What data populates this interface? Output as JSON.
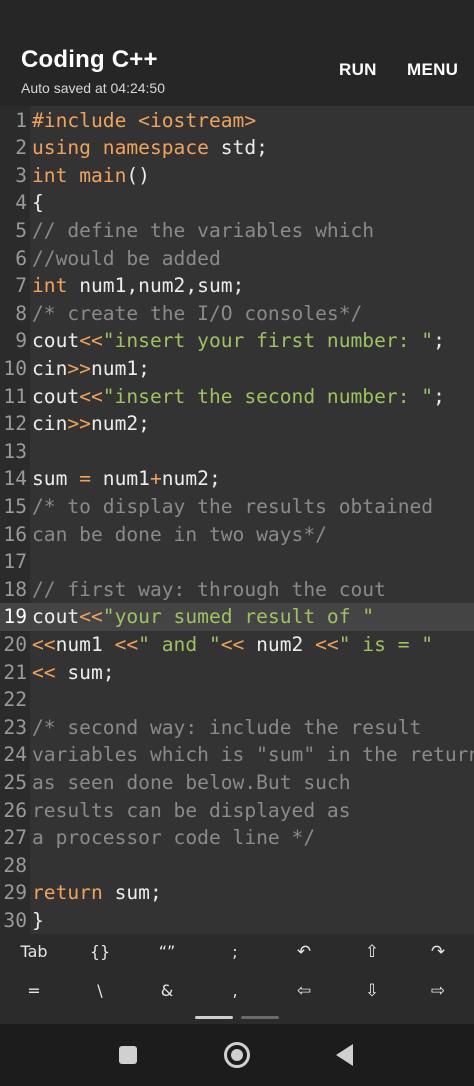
{
  "app": {
    "title": "Coding C++",
    "subtitle": "Auto saved at 04:24:50",
    "actions": {
      "run": "RUN",
      "menu": "MENU"
    }
  },
  "editor": {
    "active_line": 19,
    "lines": [
      {
        "n": "1",
        "tokens": [
          {
            "t": "#include ",
            "c": "kw"
          },
          {
            "t": "<iostream>",
            "c": "kw"
          }
        ]
      },
      {
        "n": "2",
        "tokens": [
          {
            "t": "using namespace ",
            "c": "kw"
          },
          {
            "t": "std;",
            "c": "pl"
          }
        ]
      },
      {
        "n": "3",
        "tokens": [
          {
            "t": "int ",
            "c": "kw"
          },
          {
            "t": "main",
            "c": "kw"
          },
          {
            "t": "()",
            "c": "pl"
          }
        ]
      },
      {
        "n": "4",
        "tokens": [
          {
            "t": "{",
            "c": "pl"
          }
        ]
      },
      {
        "n": "5",
        "tokens": [
          {
            "t": "// define the variables which",
            "c": "cm"
          }
        ]
      },
      {
        "n": "6",
        "tokens": [
          {
            "t": "//would be added",
            "c": "cm"
          }
        ]
      },
      {
        "n": "7",
        "tokens": [
          {
            "t": "int ",
            "c": "kw"
          },
          {
            "t": "num1,num2,sum;",
            "c": "pl"
          }
        ]
      },
      {
        "n": "8",
        "tokens": [
          {
            "t": "/* create the I/O consoles*/",
            "c": "cm"
          }
        ]
      },
      {
        "n": "9",
        "tokens": [
          {
            "t": "cout",
            "c": "pl"
          },
          {
            "t": "<<",
            "c": "op"
          },
          {
            "t": "\"insert your first number: \"",
            "c": "str"
          },
          {
            "t": ";",
            "c": "pl"
          }
        ]
      },
      {
        "n": "10",
        "tokens": [
          {
            "t": "cin",
            "c": "pl"
          },
          {
            "t": ">>",
            "c": "op"
          },
          {
            "t": "num1;",
            "c": "pl"
          }
        ]
      },
      {
        "n": "11",
        "tokens": [
          {
            "t": "cout",
            "c": "pl"
          },
          {
            "t": "<<",
            "c": "op"
          },
          {
            "t": "\"insert the second number: \"",
            "c": "str"
          },
          {
            "t": ";",
            "c": "pl"
          }
        ]
      },
      {
        "n": "12",
        "tokens": [
          {
            "t": "cin",
            "c": "pl"
          },
          {
            "t": ">>",
            "c": "op"
          },
          {
            "t": "num2;",
            "c": "pl"
          }
        ]
      },
      {
        "n": "13",
        "tokens": []
      },
      {
        "n": "14",
        "tokens": [
          {
            "t": "sum ",
            "c": "pl"
          },
          {
            "t": "=",
            "c": "op"
          },
          {
            "t": " num1",
            "c": "pl"
          },
          {
            "t": "+",
            "c": "op"
          },
          {
            "t": "num2;",
            "c": "pl"
          }
        ]
      },
      {
        "n": "15",
        "tokens": [
          {
            "t": "/* to display the results obtained",
            "c": "cm"
          }
        ]
      },
      {
        "n": "16",
        "tokens": [
          {
            "t": "can be done in two ways*/",
            "c": "cm"
          }
        ]
      },
      {
        "n": "17",
        "tokens": []
      },
      {
        "n": "18",
        "tokens": [
          {
            "t": "// first way: through the cout",
            "c": "cm"
          }
        ]
      },
      {
        "n": "19",
        "tokens": [
          {
            "t": "cout",
            "c": "pl"
          },
          {
            "t": "<<",
            "c": "op"
          },
          {
            "t": "\"your sumed result of \"",
            "c": "str"
          }
        ]
      },
      {
        "n": "20",
        "tokens": [
          {
            "t": "<<",
            "c": "op"
          },
          {
            "t": "num1 ",
            "c": "pl"
          },
          {
            "t": "<<",
            "c": "op"
          },
          {
            "t": "\" and \"",
            "c": "str"
          },
          {
            "t": "<<",
            "c": "op"
          },
          {
            "t": " num2 ",
            "c": "pl"
          },
          {
            "t": "<<",
            "c": "op"
          },
          {
            "t": "\" is = \"",
            "c": "str"
          }
        ]
      },
      {
        "n": "21",
        "tokens": [
          {
            "t": "<<",
            "c": "op"
          },
          {
            "t": " sum;",
            "c": "pl"
          }
        ]
      },
      {
        "n": "22",
        "tokens": []
      },
      {
        "n": "23",
        "tokens": [
          {
            "t": "/* second way: include the result",
            "c": "cm"
          }
        ]
      },
      {
        "n": "24",
        "tokens": [
          {
            "t": "variables which is \"sum\" in the return",
            "c": "cm"
          }
        ]
      },
      {
        "n": "25",
        "tokens": [
          {
            "t": "as seen done below.But such",
            "c": "cm"
          }
        ]
      },
      {
        "n": "26",
        "tokens": [
          {
            "t": "results can be displayed as",
            "c": "cm"
          }
        ]
      },
      {
        "n": "27",
        "tokens": [
          {
            "t": "a processor code line */",
            "c": "cm"
          }
        ]
      },
      {
        "n": "28",
        "tokens": []
      },
      {
        "n": "29",
        "tokens": [
          {
            "t": "return ",
            "c": "kw"
          },
          {
            "t": "sum;",
            "c": "pl"
          }
        ]
      },
      {
        "n": "30",
        "tokens": [
          {
            "t": "}",
            "c": "pl"
          }
        ]
      }
    ]
  },
  "keyboard": {
    "row1": [
      {
        "label": "Tab",
        "name": "tab-key"
      },
      {
        "label": "{}",
        "name": "braces-key"
      },
      {
        "label": "“”",
        "name": "quotes-key"
      },
      {
        "label": ";",
        "name": "semicolon-key"
      },
      {
        "label": "↶",
        "name": "undo-icon"
      },
      {
        "label": "⇧",
        "name": "shift-up-icon"
      },
      {
        "label": "↷",
        "name": "redo-icon"
      }
    ],
    "row2": [
      {
        "label": "=",
        "name": "equals-key"
      },
      {
        "label": "\\",
        "name": "backslash-key"
      },
      {
        "label": "&",
        "name": "ampersand-key"
      },
      {
        "label": ",",
        "name": "comma-key"
      },
      {
        "label": "⇦",
        "name": "arrow-left-icon"
      },
      {
        "label": "⇩",
        "name": "arrow-down-icon"
      },
      {
        "label": "⇨",
        "name": "arrow-right-icon"
      }
    ]
  },
  "colors": {
    "keyword": "#f0a35a",
    "string": "#9dc35e",
    "comment": "#8a8a8a",
    "editor_bg": "#333333",
    "toolbar_bg": "#262626"
  },
  "navigation": {
    "recents": "square-icon",
    "home": "circle-icon",
    "back": "triangle-back-icon"
  }
}
